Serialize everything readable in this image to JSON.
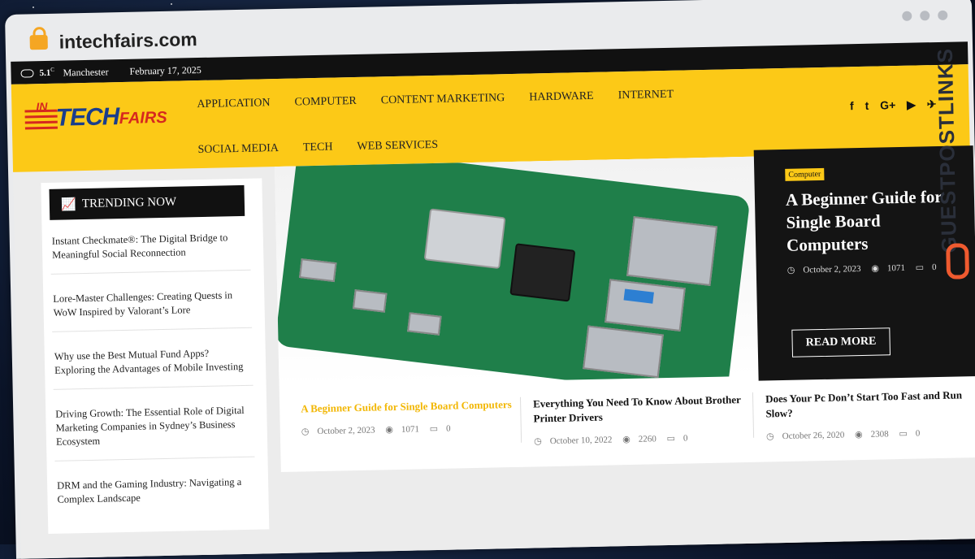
{
  "browser": {
    "url": "intechfairs.com"
  },
  "topbar": {
    "temp": "5.1",
    "unit": "C",
    "city": "Manchester",
    "date": "February 17, 2025"
  },
  "logo": {
    "in": "IN",
    "tech": "TECH",
    "fairs": "FAIRS"
  },
  "nav": [
    "APPLICATION",
    "COMPUTER",
    "CONTENT MARKETING",
    "HARDWARE",
    "INTERNET",
    "SOCIAL MEDIA",
    "TECH",
    "WEB SERVICES"
  ],
  "social": [
    "f",
    "t",
    "G+",
    "▶",
    "✈"
  ],
  "trending": {
    "heading": "TRENDING NOW",
    "items": [
      "Instant Checkmate®: The Digital Bridge to Meaningful Social Reconnection",
      "Lore-Master Challenges: Creating Quests in WoW Inspired by Valorant’s Lore",
      "Why use the Best Mutual Fund Apps? Exploring the Advantages of Mobile Investing",
      "Driving Growth: The Essential Role of Digital Marketing Companies in Sydney’s Business Ecosystem",
      "DRM and the Gaming Industry: Navigating a Complex Landscape"
    ]
  },
  "feature": {
    "category": "Computer",
    "title": "A Beginner Guide for Single Board Computers",
    "date": "October 2, 2023",
    "views": "1071",
    "comments": "0",
    "read_more": "READ MORE"
  },
  "posts": [
    {
      "title": "A Beginner Guide for Single Board Computers",
      "date": "October 2, 2023",
      "views": "1071",
      "comments": "0"
    },
    {
      "title": "Everything You Need To Know About Brother Printer Drivers",
      "date": "October 10, 2022",
      "views": "2260",
      "comments": "0"
    },
    {
      "title": "Does Your Pc Don’t Start Too Fast and Run Slow?",
      "date": "October 26, 2020",
      "views": "2308",
      "comments": "0"
    }
  ],
  "watermark": "GUESTPOSTLINKS",
  "colors": {
    "accent": "#fcc917",
    "dark": "#141414",
    "logo_blue": "#1a3e8c",
    "logo_red": "#d6281f"
  }
}
